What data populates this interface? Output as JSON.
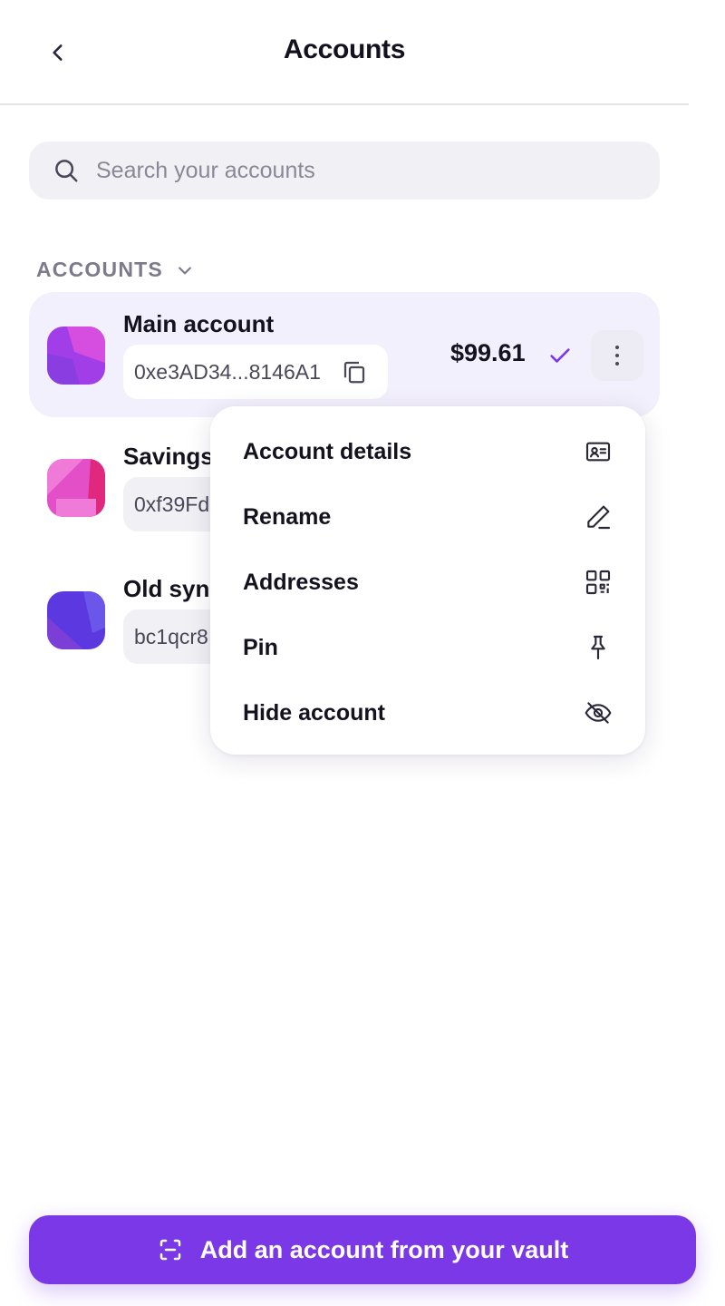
{
  "header": {
    "title": "Accounts",
    "back_icon": "chevron-left-icon"
  },
  "search": {
    "placeholder": "Search your accounts",
    "value": "",
    "icon": "search-icon"
  },
  "section": {
    "label": "ACCOUNTS",
    "icon": "chevron-down-icon"
  },
  "accounts": [
    {
      "name": "Main account",
      "address": "0xe3AD34...8146A1",
      "balance": "$99.61",
      "selected": true,
      "avatar_colors": [
        "#a23ee8",
        "#d64ee0",
        "#8a3de0"
      ]
    },
    {
      "name": "Savings",
      "address": "0xf39Fd",
      "avatar_colors": [
        "#e24fc6",
        "#f07ad8",
        "#e0287e"
      ]
    },
    {
      "name": "Old syn",
      "address": "bc1qcr8",
      "avatar_colors": [
        "#5b38e0",
        "#7b3ed6",
        "#6a56e8"
      ]
    }
  ],
  "menu": {
    "items": [
      {
        "label": "Account details",
        "icon": "id-card-icon"
      },
      {
        "label": "Rename",
        "icon": "pencil-icon"
      },
      {
        "label": "Addresses",
        "icon": "qr-code-icon"
      },
      {
        "label": "Pin",
        "icon": "pin-icon"
      },
      {
        "label": "Hide account",
        "icon": "eye-off-icon"
      }
    ]
  },
  "cta": {
    "label": "Add an account from your vault",
    "icon": "scan-icon"
  },
  "colors": {
    "accent": "#7a38e6",
    "selected_row_bg": "#f3f0fd",
    "muted_text": "#7d7a8c"
  }
}
